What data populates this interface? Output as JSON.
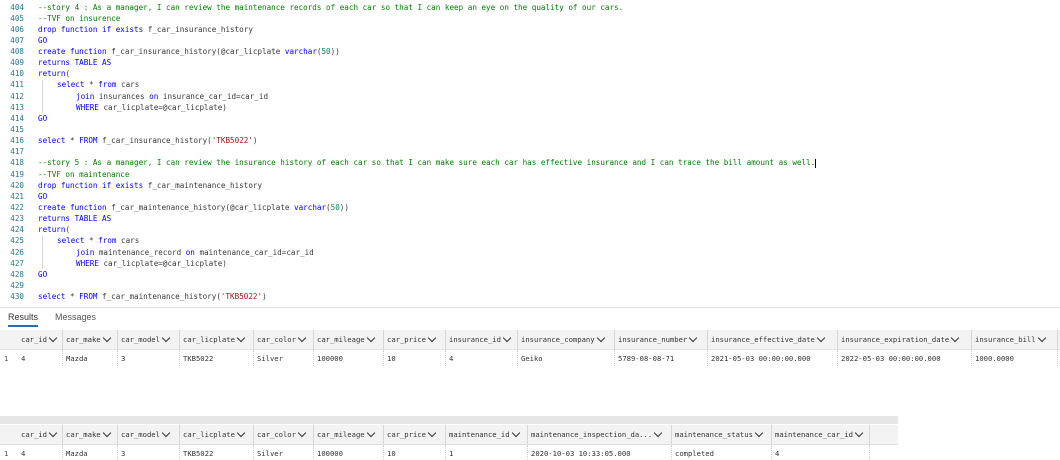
{
  "editor": {
    "lines": [
      {
        "n": "404",
        "indent": 0,
        "parts": [
          {
            "t": "--story 4 : As a manager, I can review the maintenance records of each car so that I can keep an eye on the quality of our cars.",
            "c": "cm"
          }
        ]
      },
      {
        "n": "405",
        "indent": 0,
        "parts": [
          {
            "t": "--TVF on insurence",
            "c": "cm"
          }
        ]
      },
      {
        "n": "406",
        "indent": 0,
        "parts": [
          {
            "t": "drop function if exists ",
            "c": "kw"
          },
          {
            "t": "f_car_insurance_history",
            "c": ""
          }
        ]
      },
      {
        "n": "407",
        "indent": 0,
        "parts": [
          {
            "t": "GO",
            "c": "kw"
          }
        ]
      },
      {
        "n": "408",
        "indent": 0,
        "parts": [
          {
            "t": "create function ",
            "c": "kw"
          },
          {
            "t": "f_car_insurance_history(@car_licplate ",
            "c": ""
          },
          {
            "t": "varchar",
            "c": "kw"
          },
          {
            "t": "(",
            "c": ""
          },
          {
            "t": "50",
            "c": "nu"
          },
          {
            "t": "))",
            "c": ""
          }
        ]
      },
      {
        "n": "409",
        "indent": 0,
        "parts": [
          {
            "t": "returns TABLE AS",
            "c": "kw"
          }
        ]
      },
      {
        "n": "410",
        "indent": 0,
        "parts": [
          {
            "t": "return",
            "c": "kw"
          },
          {
            "t": "(",
            "c": ""
          }
        ]
      },
      {
        "n": "411",
        "indent": 1,
        "parts": [
          {
            "t": "select ",
            "c": "kw"
          },
          {
            "t": "* ",
            "c": ""
          },
          {
            "t": "from ",
            "c": "kw"
          },
          {
            "t": "cars",
            "c": ""
          }
        ]
      },
      {
        "n": "412",
        "indent": 2,
        "parts": [
          {
            "t": "join ",
            "c": "kw"
          },
          {
            "t": "insurances ",
            "c": ""
          },
          {
            "t": "on ",
            "c": "kw"
          },
          {
            "t": "insurance_car_id=car_id",
            "c": ""
          }
        ]
      },
      {
        "n": "413",
        "indent": 2,
        "parts": [
          {
            "t": "WHERE ",
            "c": "kw"
          },
          {
            "t": "car_licplate=@car_licplate)",
            "c": ""
          }
        ]
      },
      {
        "n": "414",
        "indent": 0,
        "parts": [
          {
            "t": "GO",
            "c": "kw"
          }
        ]
      },
      {
        "n": "415",
        "indent": 0,
        "parts": []
      },
      {
        "n": "416",
        "indent": 0,
        "parts": [
          {
            "t": "select ",
            "c": "kw"
          },
          {
            "t": "* ",
            "c": ""
          },
          {
            "t": "FROM ",
            "c": "kw"
          },
          {
            "t": "f_car_insurance_history(",
            "c": ""
          },
          {
            "t": "'TKB5022'",
            "c": "st"
          },
          {
            "t": ")",
            "c": ""
          }
        ]
      },
      {
        "n": "417",
        "indent": 0,
        "parts": []
      },
      {
        "n": "418",
        "indent": 0,
        "cursor": true,
        "parts": [
          {
            "t": "--story 5 : As a manager, I can review the insurance history of each car so that I can make sure each car has effective insurance and I can trace the bill amount as well.",
            "c": "cm"
          }
        ]
      },
      {
        "n": "419",
        "indent": 0,
        "parts": [
          {
            "t": "--TVF on maintenance",
            "c": "cm"
          }
        ]
      },
      {
        "n": "420",
        "indent": 0,
        "parts": [
          {
            "t": "drop function if exists ",
            "c": "kw"
          },
          {
            "t": "f_car_maintenance_history",
            "c": ""
          }
        ]
      },
      {
        "n": "421",
        "indent": 0,
        "parts": [
          {
            "t": "GO",
            "c": "kw"
          }
        ]
      },
      {
        "n": "422",
        "indent": 0,
        "parts": [
          {
            "t": "create function ",
            "c": "kw"
          },
          {
            "t": "f_car_maintenance_history(@car_licplate ",
            "c": ""
          },
          {
            "t": "varchar",
            "c": "kw"
          },
          {
            "t": "(",
            "c": ""
          },
          {
            "t": "50",
            "c": "nu"
          },
          {
            "t": "))",
            "c": ""
          }
        ]
      },
      {
        "n": "423",
        "indent": 0,
        "parts": [
          {
            "t": "returns TABLE AS",
            "c": "kw"
          }
        ]
      },
      {
        "n": "424",
        "indent": 0,
        "parts": [
          {
            "t": "return",
            "c": "kw"
          },
          {
            "t": "(",
            "c": ""
          }
        ]
      },
      {
        "n": "425",
        "indent": 1,
        "parts": [
          {
            "t": "select ",
            "c": "kw"
          },
          {
            "t": "* ",
            "c": ""
          },
          {
            "t": "from ",
            "c": "kw"
          },
          {
            "t": "cars",
            "c": ""
          }
        ]
      },
      {
        "n": "426",
        "indent": 2,
        "parts": [
          {
            "t": "join ",
            "c": "kw"
          },
          {
            "t": "maintenance_record ",
            "c": ""
          },
          {
            "t": "on ",
            "c": "kw"
          },
          {
            "t": "maintenance_car_id=car_id",
            "c": ""
          }
        ]
      },
      {
        "n": "427",
        "indent": 2,
        "parts": [
          {
            "t": "WHERE ",
            "c": "kw"
          },
          {
            "t": "car_licplate=@car_licplate)",
            "c": ""
          }
        ]
      },
      {
        "n": "428",
        "indent": 0,
        "parts": [
          {
            "t": "GO",
            "c": "kw"
          }
        ]
      },
      {
        "n": "429",
        "indent": 0,
        "parts": []
      },
      {
        "n": "430",
        "indent": 0,
        "parts": [
          {
            "t": "select ",
            "c": "kw"
          },
          {
            "t": "* ",
            "c": ""
          },
          {
            "t": "FROM ",
            "c": "kw"
          },
          {
            "t": "f_car_maintenance_history(",
            "c": ""
          },
          {
            "t": "'TKB5022'",
            "c": "st"
          },
          {
            "t": ")",
            "c": ""
          }
        ]
      }
    ]
  },
  "results": {
    "tabs": {
      "results": "Results",
      "messages": "Messages"
    },
    "grid1": {
      "columns": [
        "car_id",
        "car_make",
        "car_model",
        "car_licplate",
        "car_color",
        "car_mileage",
        "car_price",
        "insurance_id",
        "insurance_company",
        "insurance_number",
        "insurance_effective_date",
        "insurance_expiration_date",
        "insurance_bill"
      ],
      "rows": [
        {
          "rownum": "1",
          "cells": [
            "4",
            "Mazda",
            "3",
            "TKB5022",
            "Silver",
            "100000",
            "10",
            "4",
            "Geiko",
            "5789-08-08-71",
            "2021-05-03 00:00:00.000",
            "2022-05-03 00:00:00.000",
            "1000.0000"
          ]
        }
      ]
    },
    "grid2": {
      "columns": [
        "car_id",
        "car_make",
        "car_model",
        "car_licplate",
        "car_color",
        "car_mileage",
        "car_price",
        "maintenance_id",
        "maintenance_inspection_da...",
        "maintenance_status",
        "maintenance_car_id"
      ],
      "rows": [
        {
          "rownum": "1",
          "cells": [
            "4",
            "Mazda",
            "3",
            "TKB5022",
            "Silver",
            "100000",
            "10",
            "1",
            "2020-10-03 10:33:05.000",
            "completed",
            "4"
          ]
        }
      ]
    }
  }
}
